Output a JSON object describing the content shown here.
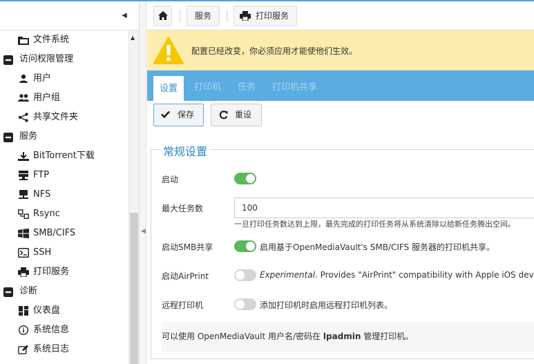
{
  "sidebar": {
    "items": [
      {
        "type": "item",
        "icon": "folder-icon",
        "label": "文件系统"
      },
      {
        "type": "group",
        "icon": "minus-square-icon",
        "label": "访问权限管理"
      },
      {
        "type": "item",
        "icon": "user-icon",
        "label": "用户"
      },
      {
        "type": "item",
        "icon": "users-icon",
        "label": "用户组"
      },
      {
        "type": "item",
        "icon": "share-icon",
        "label": "共享文件夹"
      },
      {
        "type": "group",
        "icon": "minus-square-icon",
        "label": "服务"
      },
      {
        "type": "item",
        "icon": "download-icon",
        "label": "BitTorrent下载"
      },
      {
        "type": "item",
        "icon": "server-icon",
        "label": "FTP"
      },
      {
        "type": "item",
        "icon": "network-drive-icon",
        "label": "NFS"
      },
      {
        "type": "item",
        "icon": "sync-icon",
        "label": "Rsync"
      },
      {
        "type": "item",
        "icon": "windows-icon",
        "label": "SMB/CIFS"
      },
      {
        "type": "item",
        "icon": "terminal-icon",
        "label": "SSH"
      },
      {
        "type": "item",
        "icon": "printer-icon",
        "label": "打印服务"
      },
      {
        "type": "group",
        "icon": "minus-square-icon",
        "label": "诊断"
      },
      {
        "type": "item",
        "icon": "dashboard-icon",
        "label": "仪表盘"
      },
      {
        "type": "item",
        "icon": "info-icon",
        "label": "系统信息"
      },
      {
        "type": "item",
        "icon": "edit-icon",
        "label": "系统日志"
      }
    ]
  },
  "breadcrumb": {
    "home_icon": "home-icon",
    "services": "服务",
    "current": "打印服务"
  },
  "warning": {
    "text": "配置已经改变，你必须应用才能使他们生效。"
  },
  "tabs": [
    {
      "label": "设置",
      "active": true
    },
    {
      "label": "打印机",
      "active": false
    },
    {
      "label": "任务",
      "active": false
    },
    {
      "label": "打印机共享",
      "active": false
    }
  ],
  "actions": {
    "save": "保存",
    "reset": "重设"
  },
  "form": {
    "legend": "常规设置",
    "enable_label": "启动",
    "enable_on": true,
    "max_jobs_label": "最大任务数",
    "max_jobs_value": "100",
    "max_jobs_hint": "一旦打印任务数达到上限，最先完成的打印任务将从系统清除以给新任务腾出空间。",
    "smb_label": "启动SMB共享",
    "smb_on": true,
    "smb_text": "启用基于OpenMediaVault's SMB/CIFS 服务器的打印机共享。",
    "airprint_label": "启动AirPrint",
    "airprint_on": false,
    "airprint_italic": "Experimental",
    "airprint_text": ". Provides \"AirPrint\" compatibility with Apple iOS devices.",
    "remote_label": "远程打印机",
    "remote_on": false,
    "remote_text": "添加打印机时启用远程打印机列表。",
    "note_before": "可以使用 OpenMediaVault 用户名/密码在 ",
    "note_bold": "lpadmin",
    "note_after": " 管理打印机。"
  },
  "colors": {
    "accent": "#5bace1",
    "toggle_on": "#5cb85c",
    "warning_bg": "#fcecad",
    "legend": "#2a86c6"
  }
}
